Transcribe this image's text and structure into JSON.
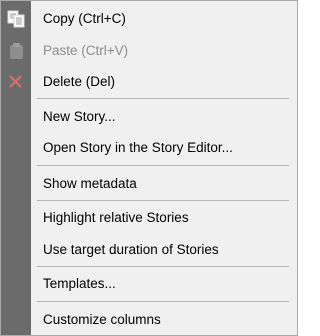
{
  "menu": {
    "items": [
      {
        "label": "Copy (Ctrl+C)",
        "icon": "copy-icon",
        "enabled": true
      },
      {
        "label": "Paste (Ctrl+V)",
        "icon": "paste-icon",
        "enabled": false
      },
      {
        "label": "Delete (Del)",
        "icon": "delete-icon",
        "enabled": true
      },
      {
        "label": "New Story...",
        "enabled": true
      },
      {
        "label": "Open Story in the Story Editor...",
        "enabled": true
      },
      {
        "label": "Show metadata",
        "enabled": true
      },
      {
        "label": "Highlight relative Stories",
        "enabled": true
      },
      {
        "label": "Use target duration of Stories",
        "enabled": true
      },
      {
        "label": "Templates...",
        "enabled": true
      },
      {
        "label": "Customize columns",
        "enabled": true
      }
    ]
  },
  "colors": {
    "gutter": "#6b6b6b",
    "background": "#f0f0f0",
    "delete_icon": "#e06a6a",
    "disabled_text": "#8d8d8d"
  }
}
